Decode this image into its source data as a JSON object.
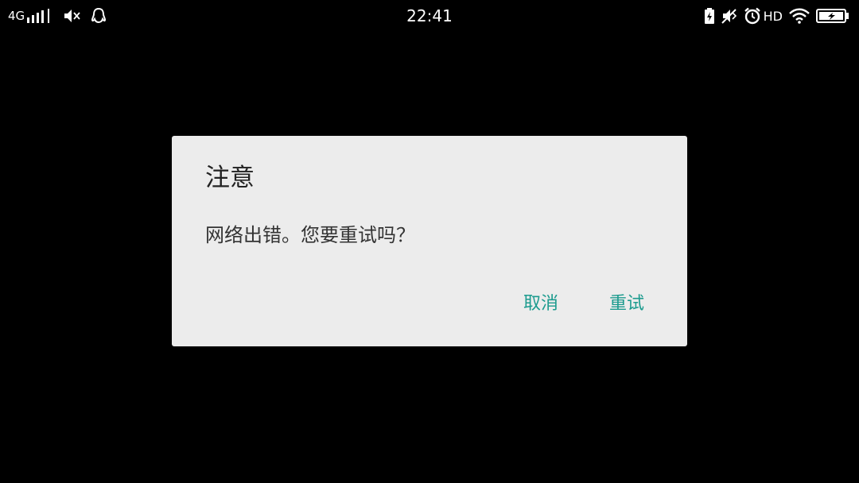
{
  "status_bar": {
    "network": "4G",
    "time": "22:41",
    "hd_label": "HD",
    "icons": {
      "signal": "signal-bars-icon",
      "speaker": "speaker-mute-icon",
      "qq": "qq-penguin-icon",
      "battery_saver": "battery-charging-small-icon",
      "vibrate_off": "notification-off-icon",
      "alarm": "alarm-clock-icon",
      "wifi": "wifi-icon",
      "battery": "battery-charging-icon"
    }
  },
  "dialog": {
    "title": "注意",
    "message": "网络出错。您要重试吗？",
    "cancel_label": "取消",
    "retry_label": "重试",
    "accent_color": "#1c9b8e",
    "background": "#ececec"
  }
}
